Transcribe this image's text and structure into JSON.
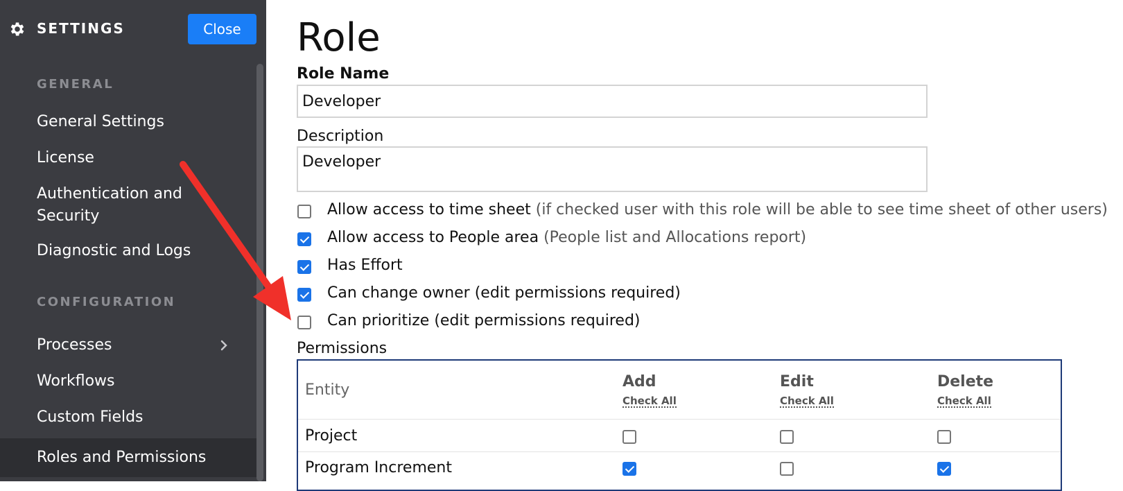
{
  "sidebar": {
    "title": "SETTINGS",
    "close_label": "Close",
    "sections": [
      {
        "label": "GENERAL",
        "items": [
          "General Settings",
          "License",
          "Authentication and Security",
          "Diagnostic and Logs"
        ]
      },
      {
        "label": "CONFIGURATION",
        "items": [
          "Processes",
          "Workflows",
          "Custom Fields",
          "Roles and Permissions"
        ]
      }
    ],
    "active_item": "Roles and Permissions"
  },
  "main": {
    "title": "Role",
    "role_name_label": "Role Name",
    "role_name_value": "Developer",
    "description_label": "Description",
    "description_value": "Developer",
    "options": [
      {
        "label": "Allow access to time sheet",
        "hint": "(if checked user with this role will be able to see time sheet of other users)",
        "checked": false
      },
      {
        "label": "Allow access to People area",
        "hint": "(People list and Allocations report)",
        "checked": true
      },
      {
        "label": "Has Effort",
        "hint": "",
        "checked": true
      },
      {
        "label": "Can change owner (edit permissions required)",
        "hint": "",
        "checked": true
      },
      {
        "label": "Can prioritize (edit permissions required)",
        "hint": "",
        "checked": false
      }
    ],
    "permissions": {
      "label": "Permissions",
      "entity_header": "Entity",
      "columns": [
        {
          "label": "Add",
          "check_all": "Check All"
        },
        {
          "label": "Edit",
          "check_all": "Check All"
        },
        {
          "label": "Delete",
          "check_all": "Check All"
        }
      ],
      "rows": [
        {
          "entity": "Project",
          "add": false,
          "edit": false,
          "delete": false
        },
        {
          "entity": "Program Increment",
          "add": true,
          "edit": false,
          "delete": true
        }
      ]
    }
  },
  "colors": {
    "sidebar_bg": "#3b3c41",
    "accent": "#1a7ef7",
    "checkbox_checked": "#1a73e8",
    "annotation_arrow": "#f0302a"
  }
}
